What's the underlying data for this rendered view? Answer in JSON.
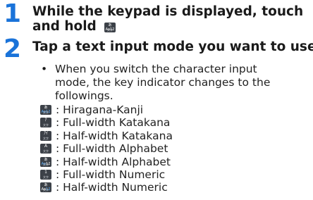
{
  "steps": [
    {
      "number": "1",
      "line1": "While the keypad is displayed, touch",
      "line2": "and hold"
    },
    {
      "number": "2",
      "line1": "Tap a text input mode you want to use"
    }
  ],
  "bullet": {
    "dot": "•",
    "lines": [
      "When you switch the character input",
      "mode, the key indicator changes to the",
      "followings."
    ]
  },
  "key_icon": {
    "top": "あAa12",
    "bottom": "文字"
  },
  "modes": [
    {
      "key_top": "あAa12",
      "key_accent": "Aa12",
      "key_bottom": "文字",
      "label": ": Hiragana-Kanji"
    },
    {
      "key_top": "ｱ",
      "key_accent": "",
      "key_bottom": "文字",
      "label": ": Full-width Katakana"
    },
    {
      "key_top": "ｱｲ",
      "key_accent": "",
      "key_bottom": "文字",
      "label": ": Half-width Katakana"
    },
    {
      "key_top": "A",
      "key_accent": "",
      "key_bottom": "文字",
      "label": ": Full-width Alphabet"
    },
    {
      "key_top": "あAa12",
      "key_accent": "Aa",
      "key_bottom": "文字",
      "label": ": Half-width Alphabet"
    },
    {
      "key_top": "1",
      "key_accent": "",
      "key_bottom": "文字",
      "label": ": Full-width Numeric"
    },
    {
      "key_top": "あAa12",
      "key_accent": "12",
      "key_bottom": "文字",
      "label": ": Half-width Numeric"
    }
  ],
  "colors": {
    "step_number": "#1a73d9",
    "key_bg": "#3c4148",
    "key_accent": "#59b0ff"
  }
}
